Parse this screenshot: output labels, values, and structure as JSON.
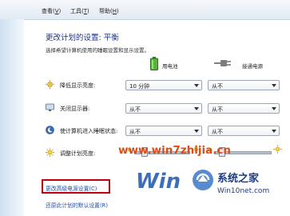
{
  "menu": {
    "view": "查看",
    "view_key": "V",
    "tools": "工具",
    "tools_key": "T",
    "help": "帮助",
    "help_key": "H"
  },
  "page": {
    "title": "更改计划的设置: 平衡",
    "subtitle": "选择希望计算机使用的睡眠设置和显示设置。"
  },
  "columns": {
    "battery": "用电池",
    "plugged": "接通电源"
  },
  "rows": [
    {
      "label": "降低显示亮度:",
      "battery": "10 分钟",
      "plugged": "从不"
    },
    {
      "label": "关闭显示器:",
      "battery": "从不",
      "plugged": "从不"
    },
    {
      "label": "使计算机进入睡眠状态:",
      "battery": "从不",
      "plugged": "从不"
    }
  ],
  "brightness": {
    "label": "调整计划亮度:",
    "battery_level": 0.15,
    "plugged_level": 0.1
  },
  "links": {
    "advanced": "更改高级电源设置(C)",
    "restore": "还原此计划的默认设置(R)"
  },
  "watermark": {
    "url": "www.win7zhijia.cn",
    "logo_brand": "系统之家",
    "logo_url": "Win10net.com"
  },
  "colors": {
    "title": "#1e3287",
    "link": "#1d4fa8",
    "highlight": "#c0000e",
    "watermark": "#e04b16"
  }
}
